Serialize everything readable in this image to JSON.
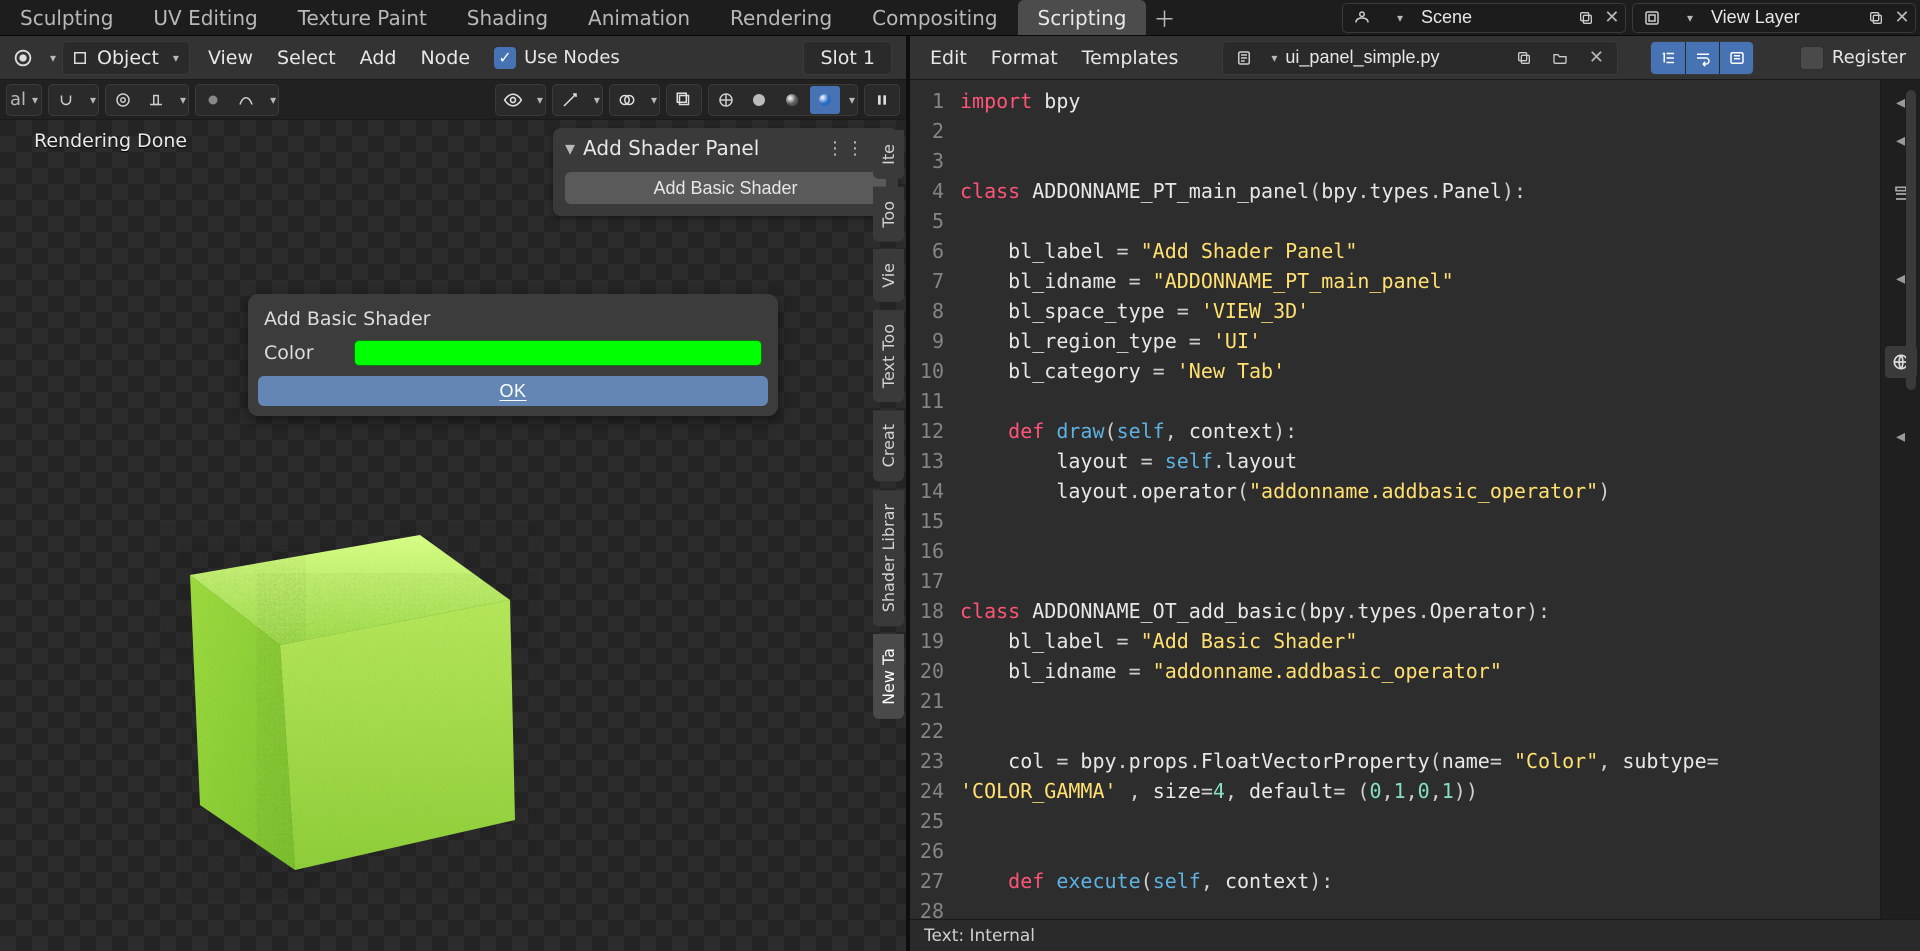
{
  "workspace_tabs": [
    "Sculpting",
    "UV Editing",
    "Texture Paint",
    "Shading",
    "Animation",
    "Rendering",
    "Compositing",
    "Scripting"
  ],
  "active_workspace": "Scripting",
  "scene_field": {
    "value": "Scene"
  },
  "viewlayer_field": {
    "value": "View Layer"
  },
  "left_header": {
    "mode_label": "Object",
    "menus": [
      "View",
      "Select",
      "Add",
      "Node"
    ],
    "use_nodes_label": "Use Nodes",
    "use_nodes_checked": true,
    "slot_label": "Slot 1"
  },
  "viewport_status": "Rendering Done",
  "n_panel": {
    "title": "Add Shader Panel",
    "button": "Add Basic Shader"
  },
  "popup": {
    "title": "Add Basic Shader",
    "color_label": "Color",
    "color_value": "#00ff00",
    "ok_label": "OK"
  },
  "side_tabs": [
    "Ite",
    "Too",
    "Vie",
    "Text Too",
    "Creat",
    "Shader Librar",
    "New Ta"
  ],
  "text_editor": {
    "menus": [
      "Edit",
      "Format",
      "Templates"
    ],
    "filename": "ui_panel_simple.py",
    "register_label": "Register",
    "footer": "Text: Internal"
  },
  "code_lines": [
    [
      {
        "t": "k",
        "v": "import"
      },
      {
        "t": "n",
        "v": " bpy"
      }
    ],
    [],
    [],
    [
      {
        "t": "k",
        "v": "class"
      },
      {
        "t": "n",
        "v": " ADDONNAME_PT_main_panel"
      },
      {
        "t": "p",
        "v": "("
      },
      {
        "t": "n",
        "v": "bpy"
      },
      {
        "t": "p",
        "v": "."
      },
      {
        "t": "n",
        "v": "types"
      },
      {
        "t": "p",
        "v": "."
      },
      {
        "t": "n",
        "v": "Panel"
      },
      {
        "t": "p",
        "v": "):"
      }
    ],
    [],
    [
      {
        "t": "n",
        "v": "    bl_label "
      },
      {
        "t": "p",
        "v": "= "
      },
      {
        "t": "s",
        "v": "\"Add Shader Panel\""
      }
    ],
    [
      {
        "t": "n",
        "v": "    bl_idname "
      },
      {
        "t": "p",
        "v": "= "
      },
      {
        "t": "s",
        "v": "\"ADDONNAME_PT_main_panel\""
      }
    ],
    [
      {
        "t": "n",
        "v": "    bl_space_type "
      },
      {
        "t": "p",
        "v": "= "
      },
      {
        "t": "s",
        "v": "'VIEW_3D'"
      }
    ],
    [
      {
        "t": "n",
        "v": "    bl_region_type "
      },
      {
        "t": "p",
        "v": "= "
      },
      {
        "t": "s",
        "v": "'UI'"
      }
    ],
    [
      {
        "t": "n",
        "v": "    bl_category "
      },
      {
        "t": "p",
        "v": "= "
      },
      {
        "t": "s",
        "v": "'New Tab'"
      }
    ],
    [],
    [
      {
        "t": "n",
        "v": "    "
      },
      {
        "t": "k",
        "v": "def"
      },
      {
        "t": "n",
        "v": " "
      },
      {
        "t": "b",
        "v": "draw"
      },
      {
        "t": "p",
        "v": "("
      },
      {
        "t": "b",
        "v": "self"
      },
      {
        "t": "p",
        "v": ", "
      },
      {
        "t": "n",
        "v": "context"
      },
      {
        "t": "p",
        "v": "):"
      }
    ],
    [
      {
        "t": "n",
        "v": "        layout "
      },
      {
        "t": "p",
        "v": "= "
      },
      {
        "t": "b",
        "v": "self"
      },
      {
        "t": "p",
        "v": "."
      },
      {
        "t": "n",
        "v": "layout"
      }
    ],
    [
      {
        "t": "n",
        "v": "        layout"
      },
      {
        "t": "p",
        "v": "."
      },
      {
        "t": "n",
        "v": "operator"
      },
      {
        "t": "p",
        "v": "("
      },
      {
        "t": "s",
        "v": "\"addonname.addbasic_operator\""
      },
      {
        "t": "p",
        "v": ")"
      }
    ],
    [],
    [],
    [],
    [
      {
        "t": "k",
        "v": "class"
      },
      {
        "t": "n",
        "v": " ADDONNAME_OT_add_basic"
      },
      {
        "t": "p",
        "v": "("
      },
      {
        "t": "n",
        "v": "bpy"
      },
      {
        "t": "p",
        "v": "."
      },
      {
        "t": "n",
        "v": "types"
      },
      {
        "t": "p",
        "v": "."
      },
      {
        "t": "n",
        "v": "Operator"
      },
      {
        "t": "p",
        "v": "):"
      }
    ],
    [
      {
        "t": "n",
        "v": "    bl_label "
      },
      {
        "t": "p",
        "v": "= "
      },
      {
        "t": "s",
        "v": "\"Add Basic Shader\""
      }
    ],
    [
      {
        "t": "n",
        "v": "    bl_idname "
      },
      {
        "t": "p",
        "v": "= "
      },
      {
        "t": "s",
        "v": "\"addonname.addbasic_operator\""
      }
    ],
    [],
    [],
    [
      {
        "t": "n",
        "v": "    col "
      },
      {
        "t": "p",
        "v": "= "
      },
      {
        "t": "n",
        "v": "bpy"
      },
      {
        "t": "p",
        "v": "."
      },
      {
        "t": "n",
        "v": "props"
      },
      {
        "t": "p",
        "v": "."
      },
      {
        "t": "n",
        "v": "FloatVectorProperty"
      },
      {
        "t": "p",
        "v": "("
      },
      {
        "t": "n",
        "v": "name"
      },
      {
        "t": "p",
        "v": "= "
      },
      {
        "t": "s",
        "v": "\"Color\""
      },
      {
        "t": "p",
        "v": ", "
      },
      {
        "t": "n",
        "v": "subtype"
      },
      {
        "t": "p",
        "v": "="
      }
    ],
    [
      {
        "t": "s",
        "v": "'COLOR_GAMMA'"
      },
      {
        "t": "n",
        "v": " "
      },
      {
        "t": "p",
        "v": ", "
      },
      {
        "t": "n",
        "v": "size"
      },
      {
        "t": "p",
        "v": "="
      },
      {
        "t": "num",
        "v": "4"
      },
      {
        "t": "p",
        "v": ", "
      },
      {
        "t": "n",
        "v": "default"
      },
      {
        "t": "p",
        "v": "= ("
      },
      {
        "t": "num",
        "v": "0"
      },
      {
        "t": "p",
        "v": ","
      },
      {
        "t": "num",
        "v": "1"
      },
      {
        "t": "p",
        "v": ","
      },
      {
        "t": "num",
        "v": "0"
      },
      {
        "t": "p",
        "v": ","
      },
      {
        "t": "num",
        "v": "1"
      },
      {
        "t": "p",
        "v": "))"
      }
    ],
    [],
    [],
    [
      {
        "t": "n",
        "v": "    "
      },
      {
        "t": "k",
        "v": "def"
      },
      {
        "t": "n",
        "v": " "
      },
      {
        "t": "b",
        "v": "execute"
      },
      {
        "t": "p",
        "v": "("
      },
      {
        "t": "b",
        "v": "self"
      },
      {
        "t": "p",
        "v": ", "
      },
      {
        "t": "n",
        "v": "context"
      },
      {
        "t": "p",
        "v": "):"
      }
    ],
    [],
    []
  ],
  "code_wrap_indent_line24": "",
  "line_start": 1
}
